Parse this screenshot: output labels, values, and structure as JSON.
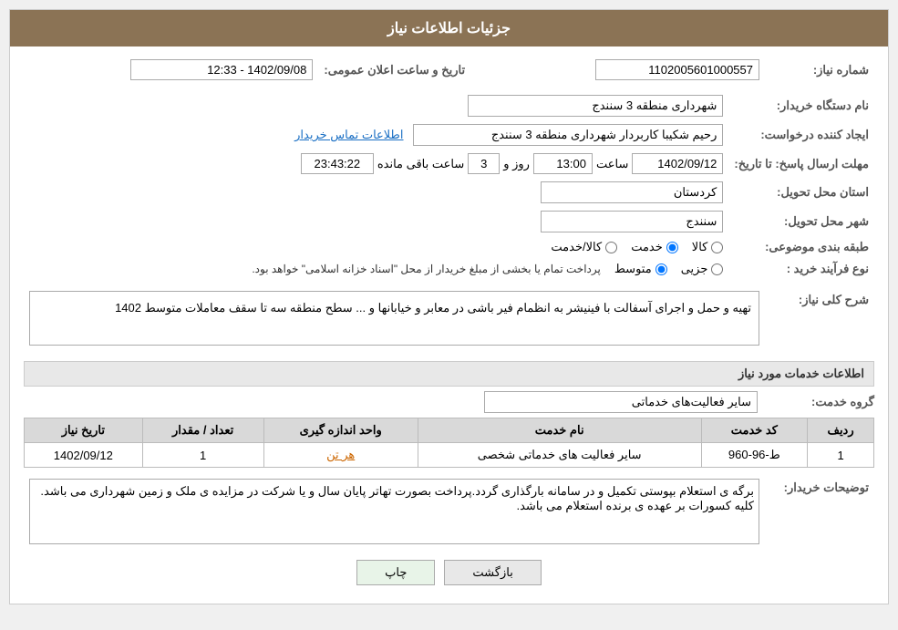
{
  "header": {
    "title": "جزئیات اطلاعات نیاز"
  },
  "fields": {
    "need_number_label": "شماره نیاز:",
    "need_number_value": "1102005601000557",
    "date_label": "تاریخ و ساعت اعلان عمومی:",
    "date_value": "1402/09/08 - 12:33",
    "buyer_org_label": "نام دستگاه خریدار:",
    "buyer_org_value": "شهرداری منطقه 3 سنندج",
    "creator_label": "ایجاد کننده درخواست:",
    "creator_value": "رحیم شکیبا کاربردار شهرداری منطقه 3 سنندج",
    "creator_link": "اطلاعات تماس خریدار",
    "deadline_label": "مهلت ارسال پاسخ: تا تاریخ:",
    "deadline_date": "1402/09/12",
    "deadline_time_label": "ساعت",
    "deadline_time": "13:00",
    "deadline_days_label": "روز و",
    "deadline_days": "3",
    "deadline_remaining_label": "ساعت باقی مانده",
    "deadline_remaining": "23:43:22",
    "province_label": "استان محل تحویل:",
    "province_value": "کردستان",
    "city_label": "شهر محل تحویل:",
    "city_value": "سنندج",
    "category_label": "طبقه بندی موضوعی:",
    "category_options": [
      "کالا",
      "خدمت",
      "کالا/خدمت"
    ],
    "category_selected": "خدمت",
    "process_label": "نوع فرآیند خرید :",
    "process_options": [
      "جزیی",
      "متوسط"
    ],
    "process_selected": "متوسط",
    "process_note": "پرداخت تمام یا بخشی از مبلغ خریدار از محل \"اسناد خزانه اسلامی\" خواهد بود.",
    "need_desc_label": "شرح کلی نیاز:",
    "need_desc_value": "تهیه  و حمل و اجرای آسفالت با فینیشر به انظمام فیر باشی در معابر و خیابانها و ... سطح منطقه سه تا سقف معاملات متوسط 1402"
  },
  "services_section": {
    "title": "اطلاعات خدمات مورد نیاز",
    "group_label": "گروه خدمت:",
    "group_value": "سایر فعالیت‌های خدماتی",
    "table": {
      "headers": [
        "ردیف",
        "کد خدمت",
        "نام خدمت",
        "واحد اندازه گیری",
        "تعداد / مقدار",
        "تاریخ نیاز"
      ],
      "rows": [
        {
          "row": "1",
          "code": "ط-96-960",
          "name": "سایر فعالیت های خدماتی شخصی",
          "unit": "هر تن",
          "quantity": "1",
          "date": "1402/09/12"
        }
      ]
    }
  },
  "notes_section": {
    "label": "توضیحات خریدار:",
    "value": "برگه ی استعلام بپوستی تکمیل و در سامانه بارگذاری گردد.پرداخت بصورت تهاتر پایان سال و یا شرکت در مزایده ی ملک و زمین شهرداری می باشد. کلیه کسورات بر عهده ی برنده استعلام می باشد."
  },
  "buttons": {
    "back": "بازگشت",
    "print": "چاپ"
  }
}
